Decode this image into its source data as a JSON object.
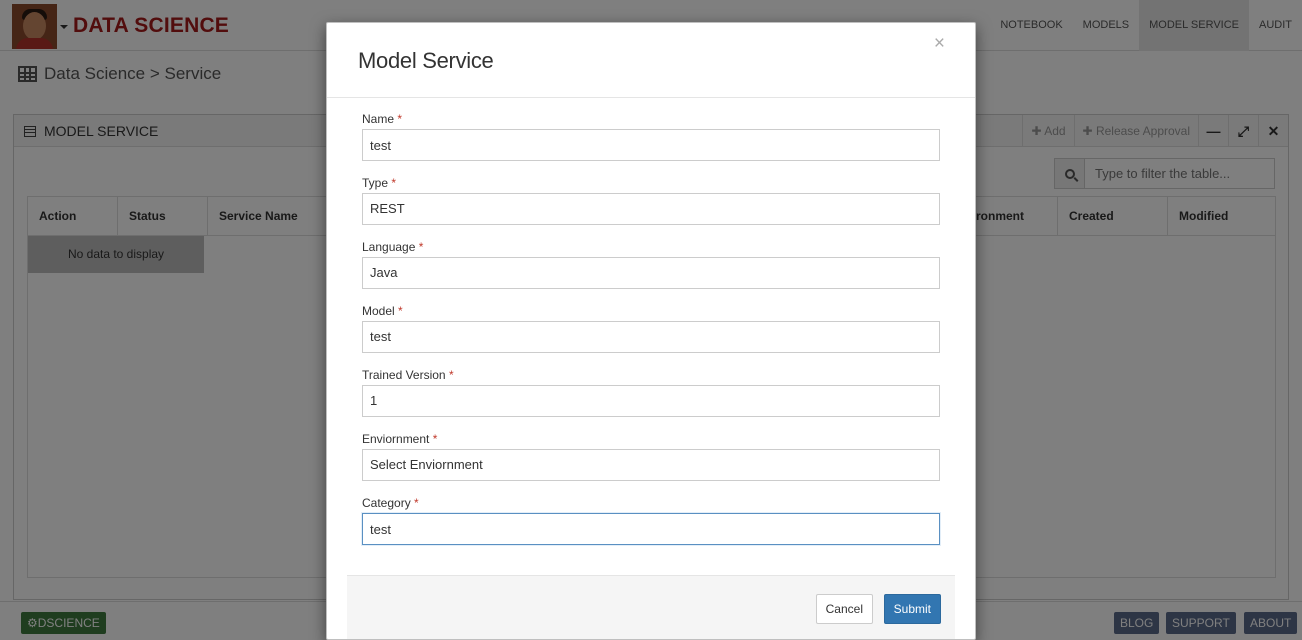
{
  "app": {
    "title": "DATA SCIENCE"
  },
  "nav": {
    "items": [
      {
        "label": "NOTEBOOK"
      },
      {
        "label": "MODELS"
      },
      {
        "label": "MODEL SERVICE"
      },
      {
        "label": "AUDIT"
      }
    ]
  },
  "breadcrumb": {
    "text": "Data Science > Service"
  },
  "widget": {
    "title": "MODEL SERVICE",
    "add_label": "Add",
    "release_label": "Release Approval",
    "filter_placeholder": "Type to filter the table...",
    "columns": [
      "Action",
      "Status",
      "Service Name",
      "ronment",
      "Created",
      "Modified"
    ],
    "empty_text": "No data to display"
  },
  "footer": {
    "brand": "DSCIENCE",
    "links": [
      "BLOG",
      "SUPPORT",
      "ABOUT"
    ]
  },
  "modal": {
    "title": "Model Service",
    "close_glyph": "×",
    "required_mark": "*",
    "fields": [
      {
        "label": "Name",
        "value": "test"
      },
      {
        "label": "Type",
        "value": "REST"
      },
      {
        "label": "Language",
        "value": "Java"
      },
      {
        "label": "Model",
        "value": "test"
      },
      {
        "label": "Trained Version",
        "value": "1"
      },
      {
        "label": "Enviornment",
        "value": "Select Enviornment"
      },
      {
        "label": "Category",
        "value": "test"
      }
    ],
    "cancel_label": "Cancel",
    "submit_label": "Submit"
  },
  "colors": {
    "brand_red": "#a41a1a",
    "primary_blue": "#3276b1",
    "brand_green": "#3e7a3e",
    "required_red": "#c0392b"
  }
}
